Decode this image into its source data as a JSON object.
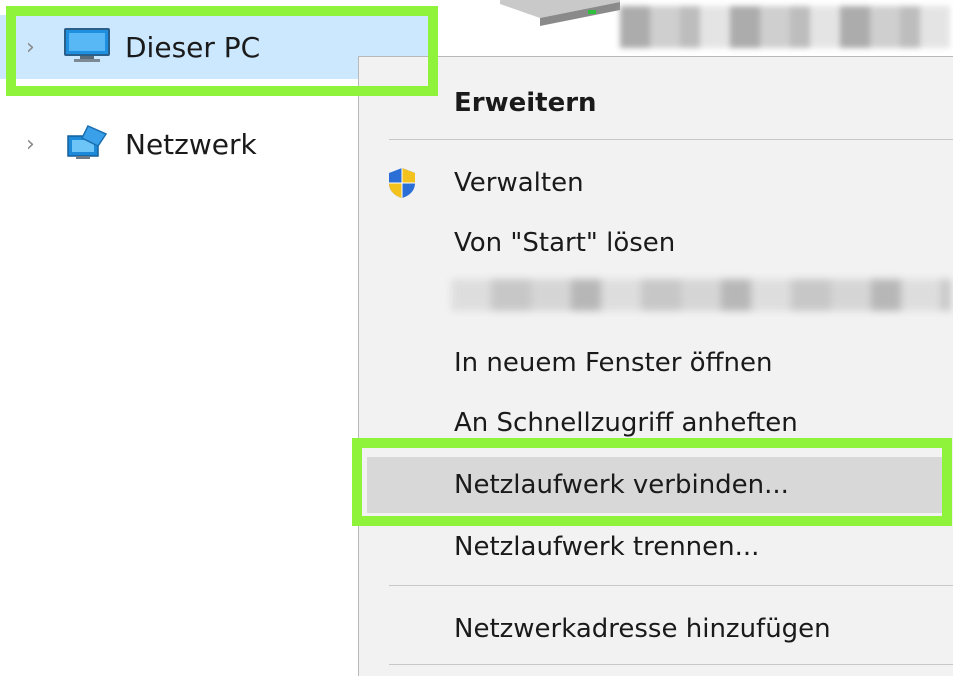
{
  "nav": {
    "items": [
      {
        "label": "Dieser PC",
        "icon": "computer-icon",
        "selected": true
      },
      {
        "label": "Netzwerk",
        "icon": "network-icon",
        "selected": false
      }
    ]
  },
  "context_menu": {
    "items": [
      {
        "label": "Erweitern",
        "bold": true
      },
      {
        "label": "Verwalten",
        "icon": "uac-shield-icon"
      },
      {
        "label": "Von \"Start\" lösen"
      },
      {
        "label": "In neuem Fenster öffnen"
      },
      {
        "label": "An Schnellzugriff anheften"
      },
      {
        "label": "Netzlaufwerk verbinden...",
        "hovered": true
      },
      {
        "label": "Netzlaufwerk trennen..."
      },
      {
        "label": "Netzwerkadresse hinzufügen"
      }
    ]
  },
  "colors": {
    "highlight": "#8ff23b",
    "selected_bg": "#cce8ff",
    "menu_bg": "#f2f2f2",
    "hover_bg": "#d8d8d8"
  }
}
